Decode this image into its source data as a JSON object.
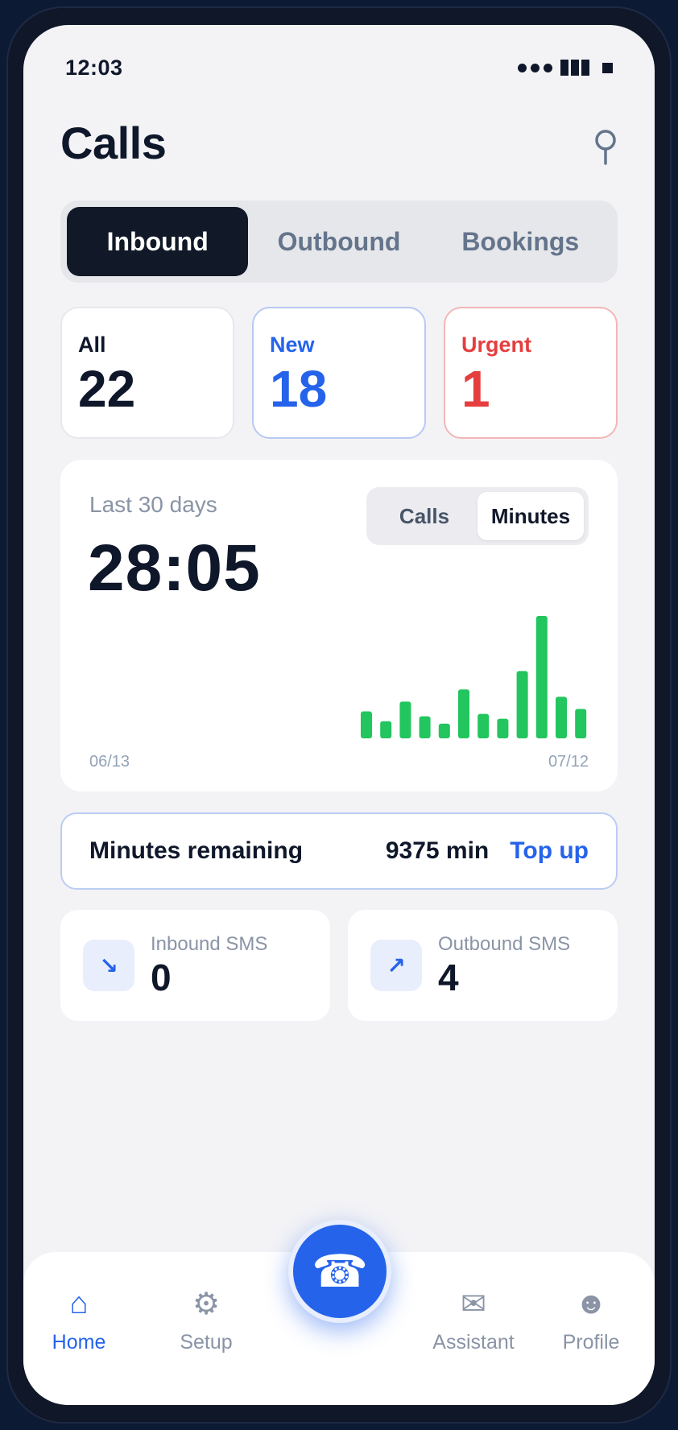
{
  "status_bar": {
    "time": "12:03"
  },
  "header": {
    "title": "Calls"
  },
  "tabs": [
    {
      "label": "Inbound",
      "active": true
    },
    {
      "label": "Outbound",
      "active": false
    },
    {
      "label": "Bookings",
      "active": false
    }
  ],
  "counters": {
    "all": {
      "label": "All",
      "value": "22"
    },
    "new": {
      "label": "New",
      "value": "18"
    },
    "urgent": {
      "label": "Urgent",
      "value": "1"
    }
  },
  "usage_card": {
    "period_label": "Last 30 days",
    "total": "28:05",
    "toggle": {
      "calls_label": "Calls",
      "minutes_label": "Minutes",
      "selected": "Minutes"
    },
    "x_start_label": "06/13",
    "x_end_label": "07/12"
  },
  "chart_data": {
    "type": "bar",
    "x_start": "06/13",
    "x_end": "07/12",
    "values": [
      2.2,
      1.4,
      3.0,
      1.8,
      1.2,
      4.0,
      2.0,
      1.6,
      5.5,
      10.0,
      3.4,
      2.4
    ],
    "color": "#22c55e"
  },
  "minutes_remaining": {
    "label": "Minutes remaining",
    "value": "9375 min",
    "action_label": "Top up"
  },
  "sms": {
    "inbound": {
      "label": "Inbound SMS",
      "value": "0",
      "icon": "arrow-down-right-icon"
    },
    "outbound": {
      "label": "Outbound SMS",
      "value": "4",
      "icon": "arrow-up-right-icon"
    }
  },
  "bottom_nav": {
    "home": {
      "label": "Home",
      "icon": "home-icon",
      "active": true
    },
    "setup": {
      "label": "Setup",
      "icon": "gear-icon"
    },
    "assistant": {
      "label": "Assistant",
      "icon": "envelope-icon"
    },
    "profile": {
      "label": "Profile",
      "icon": "smiley-icon"
    },
    "call_button": {
      "icon": "phone-icon"
    }
  },
  "colors": {
    "accent": "#2563eb",
    "urgent": "#e53e3e",
    "bar": "#22c55e",
    "dark": "#111827"
  }
}
